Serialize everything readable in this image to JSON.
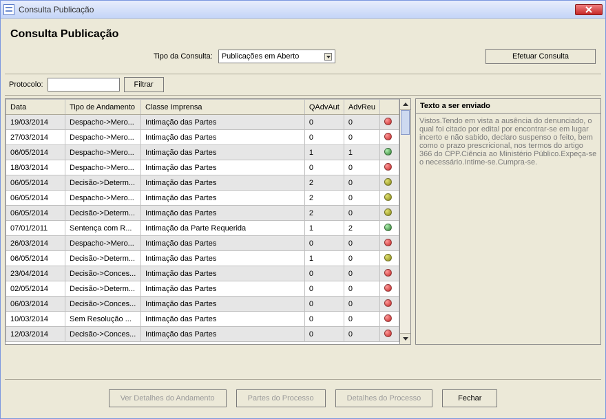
{
  "window": {
    "title": "Consulta Publicação"
  },
  "header": {
    "heading": "Consulta Publicação",
    "tipoConsultaLabel": "Tipo da Consulta:",
    "tipoConsultaValue": "Publicações em Aberto",
    "efetuarConsulta": "Efetuar Consulta"
  },
  "filter": {
    "protocoloLabel": "Protocolo:",
    "protocoloValue": "",
    "filtrarLabel": "Filtrar"
  },
  "grid": {
    "columns": {
      "data": "Data",
      "tipo": "Tipo de Andamento",
      "classe": "Classe Imprensa",
      "qaut": "QAdvAut",
      "qreu": "AdvReu",
      "status": ""
    },
    "rows": [
      {
        "data": "19/03/2014",
        "tipo": "Despacho->Mero...",
        "classe": "Intimação das Partes",
        "qaut": "0",
        "qreu": "0",
        "status": "red"
      },
      {
        "data": "27/03/2014",
        "tipo": "Despacho->Mero...",
        "classe": "Intimação das Partes",
        "qaut": "0",
        "qreu": "0",
        "status": "red"
      },
      {
        "data": "06/05/2014",
        "tipo": "Despacho->Mero...",
        "classe": "Intimação das Partes",
        "qaut": "1",
        "qreu": "1",
        "status": "green"
      },
      {
        "data": "18/03/2014",
        "tipo": "Despacho->Mero...",
        "classe": "Intimação das Partes",
        "qaut": "0",
        "qreu": "0",
        "status": "red"
      },
      {
        "data": "06/05/2014",
        "tipo": "Decisão->Determ...",
        "classe": "Intimação das Partes",
        "qaut": "2",
        "qreu": "0",
        "status": "olive"
      },
      {
        "data": "06/05/2014",
        "tipo": "Despacho->Mero...",
        "classe": "Intimação das Partes",
        "qaut": "2",
        "qreu": "0",
        "status": "olive"
      },
      {
        "data": "06/05/2014",
        "tipo": "Decisão->Determ...",
        "classe": "Intimação das Partes",
        "qaut": "2",
        "qreu": "0",
        "status": "olive"
      },
      {
        "data": "07/01/2011",
        "tipo": "Sentença com R...",
        "classe": "Intimação da Parte Requerida",
        "qaut": "1",
        "qreu": "2",
        "status": "green"
      },
      {
        "data": "26/03/2014",
        "tipo": "Despacho->Mero...",
        "classe": "Intimação das Partes",
        "qaut": "0",
        "qreu": "0",
        "status": "red"
      },
      {
        "data": "06/05/2014",
        "tipo": "Decisão->Determ...",
        "classe": "Intimação das Partes",
        "qaut": "1",
        "qreu": "0",
        "status": "olive"
      },
      {
        "data": "23/04/2014",
        "tipo": "Decisão->Conces...",
        "classe": "Intimação das Partes",
        "qaut": "0",
        "qreu": "0",
        "status": "red"
      },
      {
        "data": "02/05/2014",
        "tipo": "Decisão->Determ...",
        "classe": "Intimação das Partes",
        "qaut": "0",
        "qreu": "0",
        "status": "red"
      },
      {
        "data": "06/03/2014",
        "tipo": "Decisão->Conces...",
        "classe": "Intimação das Partes",
        "qaut": "0",
        "qreu": "0",
        "status": "red"
      },
      {
        "data": "10/03/2014",
        "tipo": "Sem Resolução ...",
        "classe": "Intimação das Partes",
        "qaut": "0",
        "qreu": "0",
        "status": "red"
      },
      {
        "data": "12/03/2014",
        "tipo": "Decisão->Conces...",
        "classe": "Intimação das Partes",
        "qaut": "0",
        "qreu": "0",
        "status": "red"
      }
    ]
  },
  "side": {
    "header": "Texto a ser enviado",
    "text": "Vistos.Tendo em vista a ausência do denunciado, o qual foi citado por edital por encontrar-se em lugar incerto e não sabido, declaro suspenso o feito, bem como o prazo prescricional, nos termos do artigo 366 do CPP.Ciência ao Ministério Público.Expeça-se o necessário.Intime-se.Cumpra-se."
  },
  "buttons": {
    "detalhesAndamento": "Ver Detalhes do Andamento",
    "partesProcesso": "Partes do Processo",
    "detalhesProcesso": "Detalhes do Processo",
    "fechar": "Fechar"
  }
}
